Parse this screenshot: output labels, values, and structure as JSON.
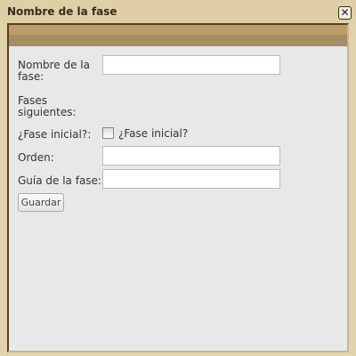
{
  "dialog": {
    "title": "Nombre de la fase",
    "close_icon": "close-icon"
  },
  "form": {
    "nombre_label": "Nombre de la fase:",
    "nombre_value": "",
    "fases_label": "Fases siguientes:",
    "inicial_label": "¿Fase inicial?:",
    "inicial_checkbox_label": "¿Fase inicial?",
    "inicial_checked": false,
    "orden_label": "Orden:",
    "orden_value": "",
    "guia_label": "Guía de la fase:",
    "guia_value": "",
    "save_label": "Guardar"
  }
}
